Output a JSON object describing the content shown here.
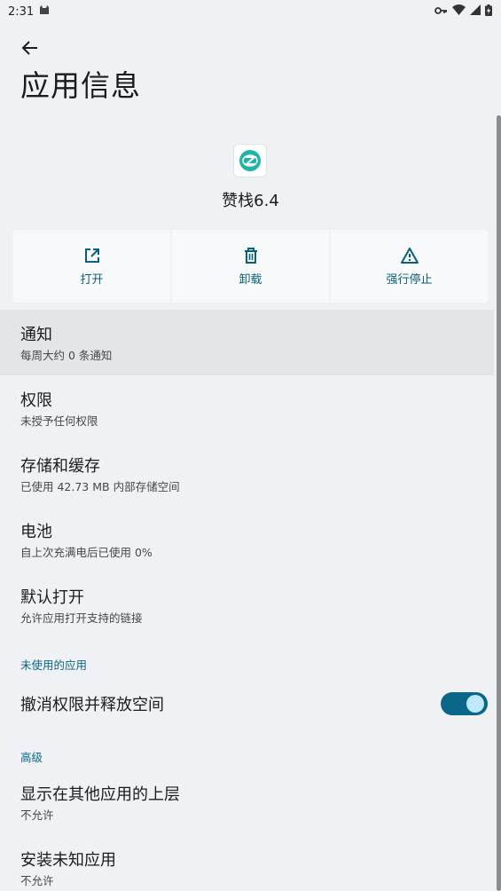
{
  "status_bar": {
    "time": "2:31"
  },
  "header": {
    "title": "应用信息"
  },
  "app": {
    "name": "赞栈6.4"
  },
  "actions": [
    {
      "label": "打开",
      "icon": "open-in-new-icon"
    },
    {
      "label": "卸载",
      "icon": "trash-icon"
    },
    {
      "label": "强行停止",
      "icon": "warning-icon"
    }
  ],
  "items": {
    "notifications": {
      "title": "通知",
      "sub": "每周大约 0 条通知"
    },
    "permissions": {
      "title": "权限",
      "sub": "未授予任何权限"
    },
    "storage": {
      "title": "存储和缓存",
      "sub": "已使用 42.73 MB 内部存储空间"
    },
    "battery": {
      "title": "电池",
      "sub": "自上次充满电后已使用 0%"
    },
    "open_by_default": {
      "title": "默认打开",
      "sub": "允许应用打开支持的链接"
    }
  },
  "unused_section": {
    "heading": "未使用的应用",
    "toggle_title": "撤消权限并释放空间",
    "toggle_on": true
  },
  "advanced_section": {
    "heading": "高级",
    "overlay": {
      "title": "显示在其他应用的上层",
      "sub": "不允许"
    },
    "install_unknown": {
      "title": "安装未知应用",
      "sub": "不允许"
    }
  },
  "colors": {
    "accent": "#0a6789",
    "background": "#eff1f4"
  }
}
